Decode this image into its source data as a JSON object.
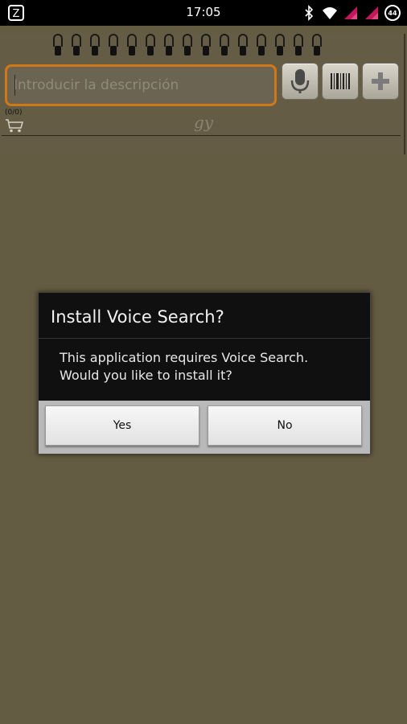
{
  "status_bar": {
    "time": "17:05",
    "battery_level": "44",
    "icons": [
      "app-notification-icon",
      "bluetooth-icon",
      "wifi-icon",
      "signal-icon",
      "signal-icon",
      "battery-icon"
    ]
  },
  "toolbar": {
    "search_placeholder": "Introducir la descripción",
    "buttons": [
      "microphone-icon",
      "barcode-icon",
      "plus-icon"
    ]
  },
  "list": {
    "count": "(0/0)",
    "title": "gy"
  },
  "dialog": {
    "title": "Install Voice Search?",
    "message_line1": "This application requires Voice Search.",
    "message_line2": "Would you like to install it?",
    "yes_label": "Yes",
    "no_label": "No"
  },
  "colors": {
    "notebook_bg": "#635b42",
    "search_border": "#d07818",
    "dialog_bg": "#101010",
    "signal_accent": "#c2185b"
  }
}
